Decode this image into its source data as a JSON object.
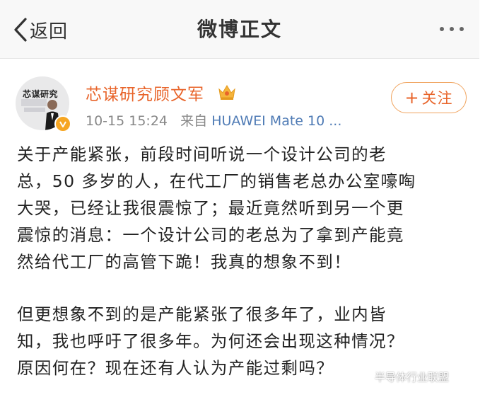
{
  "header": {
    "back_label": "返回",
    "title": "微博正文"
  },
  "post": {
    "avatar_text": "芯谋研究",
    "username": "芯谋研究顾文军",
    "timestamp": "10-15 15:24",
    "source_prefix": "来自",
    "source_device": "HUAWEI Mate 10 ...",
    "follow_label": "关注",
    "paragraphs": [
      [
        "关于产能紧张，前段时间听说一个设计公司的老",
        "总，50 多岁的人，在代工厂的销售老总办公室嚎啕",
        "大哭，已经让我很震惊了；最近竟然听到另一个更",
        "震惊的消息：一个设计公司的老总为了拿到产能竟",
        "然给代工厂的高管下跪！我真的想象不到！"
      ],
      [
        "但更想象不到的是产能紧张了很多年了，业内皆",
        "知，我也呼吁了很多年。为何还会出现这种情况？",
        "原因何在？现在还有人认为产能过剩吗？"
      ]
    ]
  },
  "watermark": {
    "text": "半导体行业联盟",
    "icon": "wechat-icon"
  },
  "colors": {
    "accent": "#e8642a",
    "link": "#4f7bb5",
    "meta": "#888888",
    "verified": "#f6a623"
  }
}
